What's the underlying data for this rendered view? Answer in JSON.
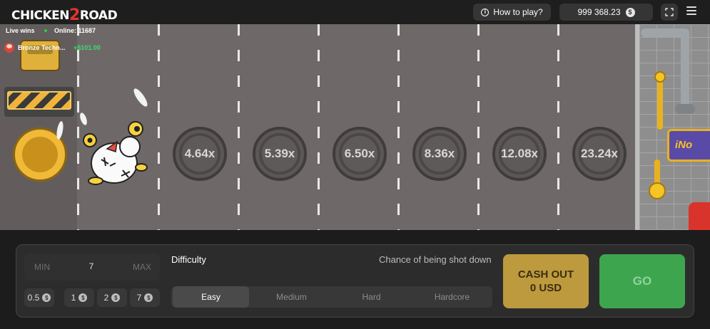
{
  "header": {
    "logo_part1": "CHICKEN",
    "logo_num": "2",
    "logo_part2": "ROAD",
    "how_to_play": "How to play?",
    "balance": "999 368.23",
    "currency_symbol": "$"
  },
  "live": {
    "title": "Live wins",
    "online": "Online: 11687",
    "wins": [
      {
        "user": "Bronze Techn...",
        "amount": "+$101.00"
      }
    ]
  },
  "road": {
    "multipliers": [
      "4.64x",
      "5.39x",
      "6.50x",
      "8.36x",
      "12.08x",
      "23.24x"
    ],
    "sign_text": "iNo"
  },
  "controls": {
    "bet": {
      "min_label": "MIN",
      "value": "7",
      "max_label": "MAX"
    },
    "chips": [
      "0.5",
      "1",
      "2",
      "7"
    ],
    "difficulty_label": "Difficulty",
    "chance_label": "Chance of being shot down",
    "difficulties": [
      "Easy",
      "Medium",
      "Hard",
      "Hardcore"
    ],
    "selected_difficulty": "Easy",
    "cashout_line1": "CASH OUT",
    "cashout_line2": "0 USD",
    "go_label": "GO"
  },
  "colors": {
    "go": "#3ea54f",
    "cashout": "#bd9a3d",
    "win_amount": "#40d96d"
  }
}
